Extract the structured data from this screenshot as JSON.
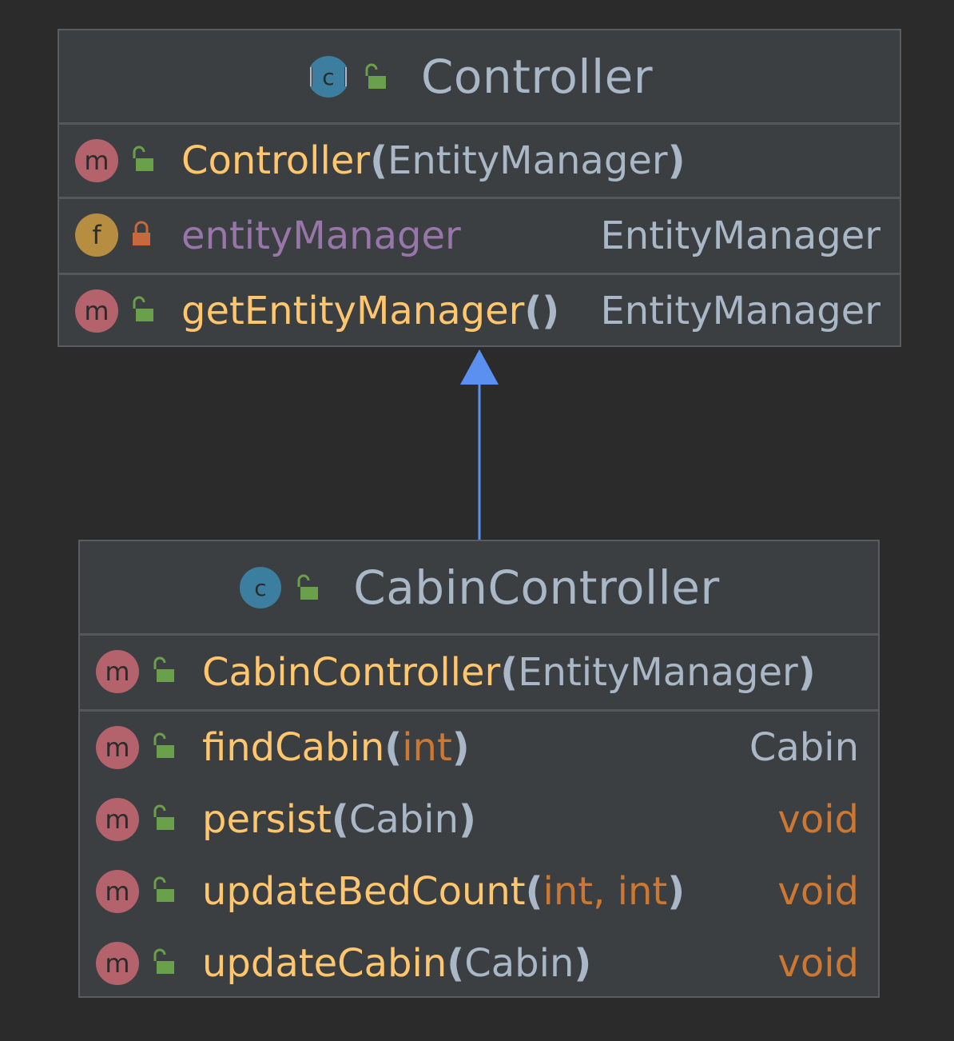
{
  "diagram": {
    "colors": {
      "background": "#2b2b2b",
      "class_fill": "#3c3f41",
      "class_border": "#5a5d5f",
      "method_name": "#ffc66d",
      "field_name": "#9876aa",
      "type_text": "#a9b7c6",
      "primitive": "#cc7832",
      "arrow": "#5b8ff0",
      "method_badge": "#b4636c",
      "field_badge": "#b78d41",
      "class_badge": "#3c7ea0",
      "lock_public": "#6a9f4c",
      "lock_private": "#c7693d"
    },
    "controller": {
      "name": "Controller",
      "kind_icon": "abstract-class-icon",
      "badge_letter": "C",
      "constructors": [
        {
          "name": "Controller",
          "open": "(",
          "params": "EntityManager",
          "close": ")"
        }
      ],
      "fields": [
        {
          "name": "entityManager",
          "type": "EntityManager",
          "badge": "f"
        }
      ],
      "methods": [
        {
          "name": "getEntityManager",
          "parens": "()",
          "type": "EntityManager",
          "badge": "m"
        }
      ]
    },
    "cabin_controller": {
      "name": "CabinController",
      "kind_icon": "class-icon",
      "badge_letter": "C",
      "constructors": [
        {
          "name": "CabinController",
          "open": "(",
          "params": "EntityManager",
          "close": ")"
        }
      ],
      "methods": [
        {
          "name": "findCabin",
          "open": "(",
          "params": "int",
          "close": ")",
          "type": "Cabin",
          "badge": "m"
        },
        {
          "name": "persist",
          "open": "(",
          "params": "Cabin",
          "close": ")",
          "type": "void",
          "badge": "m"
        },
        {
          "name": "updateBedCount",
          "open": "(",
          "params": "int, int",
          "close": ")",
          "type": "void",
          "badge": "m"
        },
        {
          "name": "updateCabin",
          "open": "(",
          "params": "Cabin",
          "close": ")",
          "type": "void",
          "badge": "m"
        }
      ]
    },
    "relationship": {
      "type": "inheritance",
      "from": "CabinController",
      "to": "Controller"
    }
  }
}
